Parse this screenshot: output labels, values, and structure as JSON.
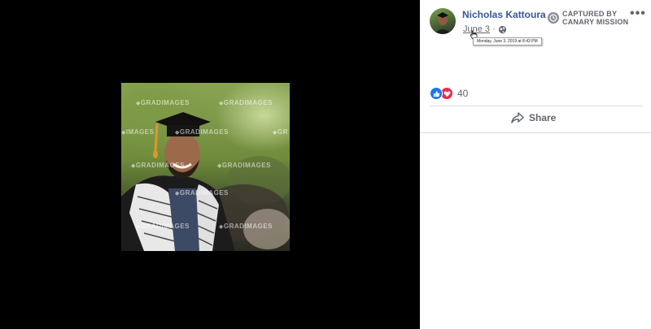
{
  "post": {
    "author": "Nicholas Kattoura",
    "date": "June 3",
    "separator": "·",
    "date_tooltip": "Monday, June 3, 2019 at 8:43 PM",
    "captured_by": [
      "CAPTURED BY",
      "CANARY MISSION"
    ],
    "more_label": "•••",
    "reaction_count": "40",
    "share_label": "Share"
  },
  "photo": {
    "watermark_text": "GRADIMAGES",
    "partial_left": "IMAGES",
    "partial_right": "GR"
  },
  "icons": {
    "privacy": "globe-icon",
    "captured": "clock-icon",
    "reactions": [
      "like-icon",
      "love-icon"
    ],
    "share": "share-arrow-icon"
  },
  "colors": {
    "author": "#385898",
    "like": "#1877f2",
    "love": "#f0284a",
    "muted": "#606770"
  }
}
